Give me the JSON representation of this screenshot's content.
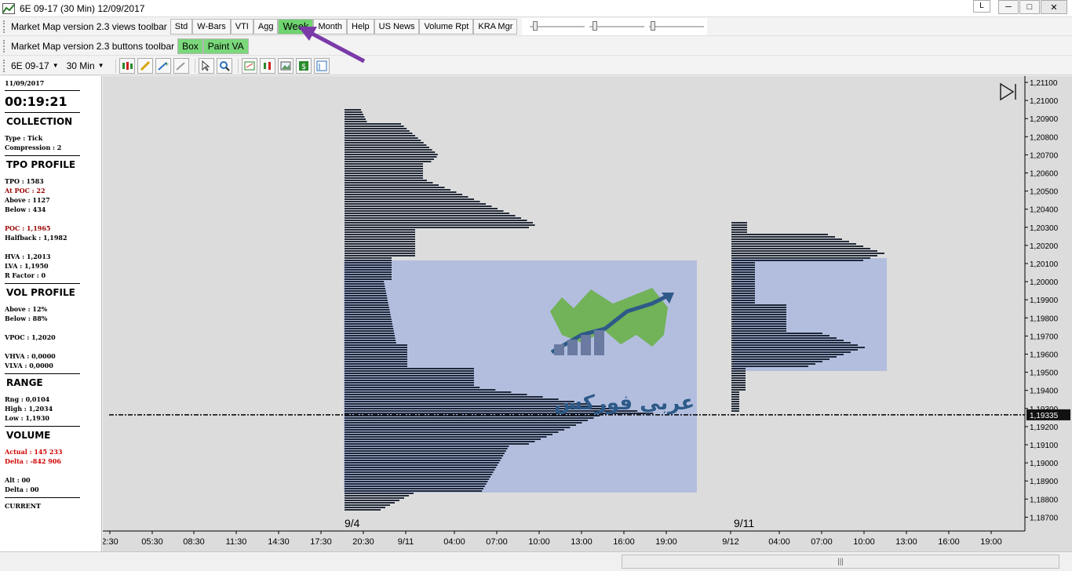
{
  "window": {
    "title": "6E 09-17 (30 Min)  12/09/2017",
    "l_button": "L",
    "minimize": "─",
    "maximize": "□",
    "close": "✕"
  },
  "views_toolbar": {
    "label": "Market Map version 2.3  views toolbar",
    "buttons": [
      "Std",
      "W-Bars",
      "VTI",
      "Agg",
      "Week",
      "Month",
      "Help",
      "US News",
      "Volume Rpt",
      "KRA Mgr"
    ],
    "active": "Week"
  },
  "buttons_toolbar": {
    "label": "Market Map version 2.3  buttons toolbar",
    "buttons": [
      "Box",
      "Paint VA"
    ]
  },
  "chart_toolbar": {
    "instrument": "6E 09-17",
    "interval": "30 Min"
  },
  "sidebar": {
    "date": "11/09/2017",
    "time": "00:19:21",
    "collection": {
      "title": "COLLECTION",
      "type": "Type : Tick",
      "compression": "Compression : 2"
    },
    "tpo": {
      "title": "TPO PROFILE",
      "tpo": "TPO : 1583",
      "at_poc": "At POC : 22",
      "above": "Above : 1127",
      "below": "Below : 434",
      "poc": "POC : 1,1965",
      "halfback": "Halfback : 1,1982",
      "hva": "HVA : 1,2013",
      "lva": "LVA : 1,1950",
      "rfactor": "R Factor : 0"
    },
    "vol": {
      "title": "VOL PROFILE",
      "above": "Above : 12%",
      "below": "Below : 88%",
      "vpoc": "VPOC : 1,2020",
      "vhva": "VHVA : 0,0000",
      "vlva": "VLVA : 0,0000"
    },
    "range": {
      "title": "RANGE",
      "rng": "Rng : 0,0104",
      "high": "High : 1,2034",
      "low": "Low : 1,1930"
    },
    "volume": {
      "title": "VOLUME",
      "actual": "Actual : 145 233",
      "delta": "Delta : -842 906",
      "alt": "Alt : 00",
      "delta2": "Delta : 00",
      "current": "CURRENT"
    }
  },
  "chart": {
    "price_labels": [
      "1,21100",
      "1,21000",
      "1,20900",
      "1,20800",
      "1,20700",
      "1,20600",
      "1,20500",
      "1,20400",
      "1,20300",
      "1,20200",
      "1,20100",
      "1,20000",
      "1,19900",
      "1,19800",
      "1,19700",
      "1,19600",
      "1,19500",
      "1,19400",
      "1,19300",
      "1,19200",
      "1,19100",
      "1,19000",
      "1,18900",
      "1,18800",
      "1,18700"
    ],
    "current_price": "1,19335",
    "time_labels": [
      "2:30",
      "05:30",
      "08:30",
      "11:30",
      "14:30",
      "17:30",
      "20:30",
      "9/11",
      "04:00",
      "07:00",
      "10:00",
      "13:00",
      "16:00",
      "19:00",
      "9/12",
      "04:00",
      "07:00",
      "10:00",
      "13:00",
      "16:00",
      "19:00"
    ],
    "session_labels": [
      "9/4",
      "9/11"
    ],
    "watermark": "عربي فوركس",
    "colors": {
      "background": "#dcdcdc",
      "value_area": "#b3bedf",
      "profile": "#0d1626",
      "accent_green": "#6fd46f",
      "arrow": "#7a3aa8"
    }
  }
}
